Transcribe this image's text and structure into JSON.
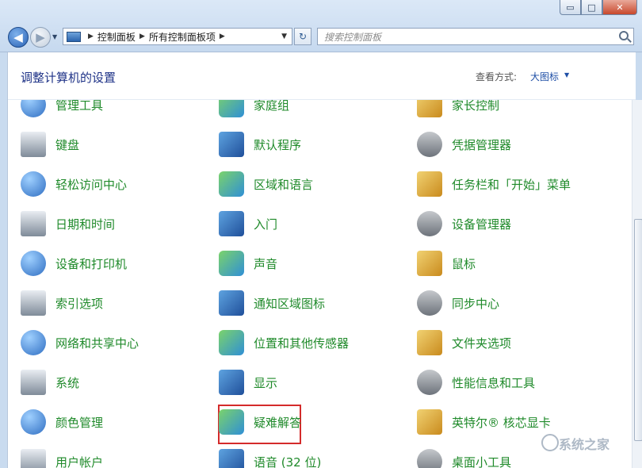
{
  "window": {
    "minimize": "▭",
    "maximize": "□",
    "close": "✕"
  },
  "nav": {
    "back": "◀",
    "forward": "▶",
    "dropdown": "▼"
  },
  "address": {
    "segments": [
      "控制面板",
      "所有控制面板项"
    ],
    "separator": "▶",
    "dropdown": "▼"
  },
  "refresh": "↻",
  "search": {
    "placeholder": "搜索控制面板"
  },
  "header": {
    "title": "调整计算机的设置",
    "view_label": "查看方式:",
    "view_value": "大图标",
    "view_dropdown": "▼"
  },
  "items": [
    [
      "管理工具",
      "家庭组",
      "家长控制"
    ],
    [
      "键盘",
      "默认程序",
      "凭据管理器"
    ],
    [
      "轻松访问中心",
      "区域和语言",
      "任务栏和「开始」菜单"
    ],
    [
      "日期和时间",
      "入门",
      "设备管理器"
    ],
    [
      "设备和打印机",
      "声音",
      "鼠标"
    ],
    [
      "索引选项",
      "通知区域图标",
      "同步中心"
    ],
    [
      "网络和共享中心",
      "位置和其他传感器",
      "文件夹选项"
    ],
    [
      "系统",
      "显示",
      "性能信息和工具"
    ],
    [
      "颜色管理",
      "疑难解答",
      "英特尔® 核芯显卡"
    ],
    [
      "用户帐户",
      "语音 (32 位)",
      "桌面小工具"
    ]
  ],
  "watermark": "系统之家"
}
